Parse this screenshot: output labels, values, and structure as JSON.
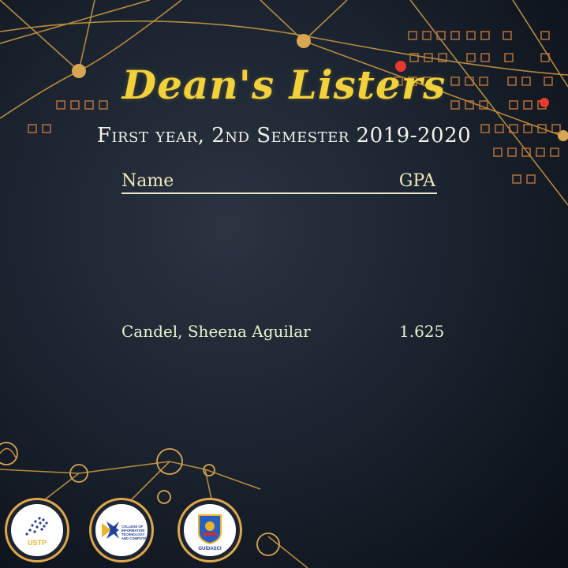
{
  "title": "Dean's Listers",
  "subtitle": "First year, 2nd Semester 2019-2020",
  "table": {
    "header_name": "Name",
    "header_gpa": "GPA",
    "rows": [
      {
        "name": "Candel, Sheena Aguilar",
        "gpa": "1.625"
      }
    ]
  },
  "logos": [
    {
      "icon": "ustp-seal-icon",
      "text": "USTP"
    },
    {
      "icon": "citc-seal-icon",
      "text": "COLLEGE OF INFORMATION TECHNOLOGY AND COMPUTING"
    },
    {
      "icon": "guidasci-seal-icon",
      "text": "GUIDASCI"
    }
  ],
  "colors": {
    "background": "#141b25",
    "title": "#f2d13a",
    "accent_line": "#e0a84a",
    "glow": "#ff3b2f"
  }
}
